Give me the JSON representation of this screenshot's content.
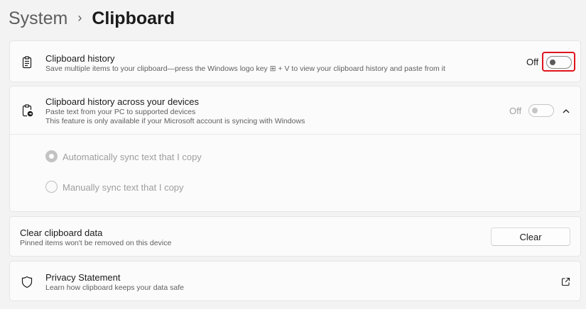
{
  "breadcrumb": {
    "parent": "System",
    "separator": "›",
    "current": "Clipboard"
  },
  "clipboard_history": {
    "title": "Clipboard history",
    "description": "Save multiple items to your clipboard—press the Windows logo key ⊞ + V to view your clipboard history and paste from it",
    "state": "Off",
    "enabled": false
  },
  "sync_devices": {
    "title": "Clipboard history across your devices",
    "description_1": "Paste text from your PC to supported devices",
    "description_2": "This feature is only available if your Microsoft account is syncing with Windows",
    "state": "Off",
    "options": [
      {
        "label": "Automatically sync text that I copy",
        "selected": true
      },
      {
        "label": "Manually sync text that I copy",
        "selected": false
      }
    ]
  },
  "clear_data": {
    "title": "Clear clipboard data",
    "description": "Pinned items won't be removed on this device",
    "button_label": "Clear"
  },
  "privacy": {
    "title": "Privacy Statement",
    "description": "Learn how clipboard keeps your data safe"
  },
  "colors": {
    "highlight": "#e0141e",
    "background": "#f3f3f3",
    "card": "#fbfbfb"
  }
}
